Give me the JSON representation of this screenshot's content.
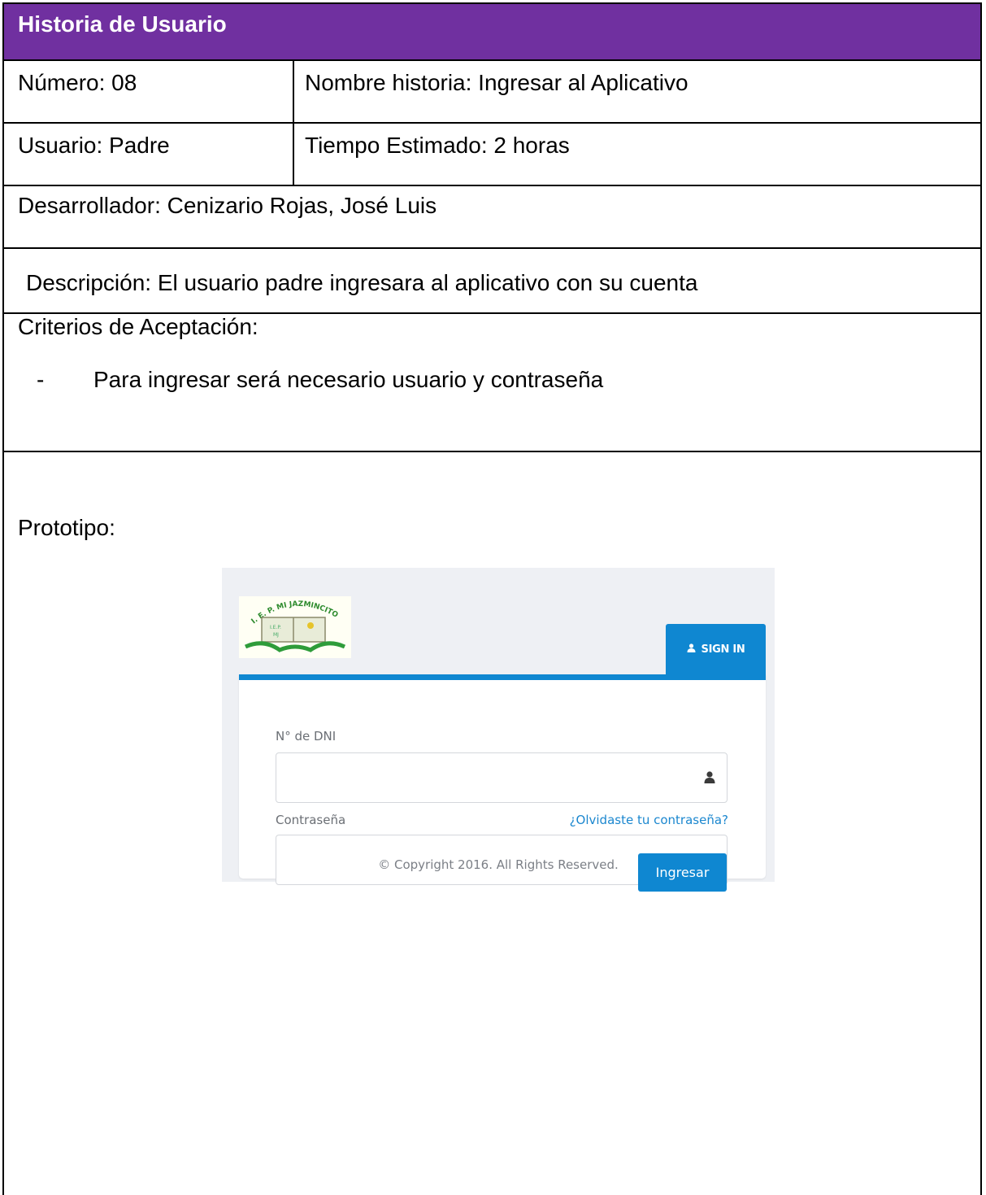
{
  "header": {
    "title": "Historia de Usuario"
  },
  "row1": {
    "numero": "Número: 08",
    "nombre": "Nombre historia: Ingresar al Aplicativo"
  },
  "row2": {
    "usuario": "Usuario: Padre",
    "tiempo": "Tiempo Estimado: 2 horas"
  },
  "desarrollador": "Desarrollador: Cenizario Rojas, José Luis",
  "descripcion": "Descripción: El usuario padre ingresara al aplicativo con su cuenta",
  "criterios": {
    "title": "Criterios de Aceptación:",
    "bullet": "-",
    "items": [
      "Para ingresar será necesario usuario y contraseña"
    ]
  },
  "prototipo": {
    "label": "Prototipo:",
    "logo_text": "I. E. P. MI JAZMINCITO",
    "tab_label": "SIGN IN",
    "dni_label": "N° de DNI",
    "password_label": "Contraseña",
    "forgot_link": "¿Olvidaste tu contraseña?",
    "submit_label": "Ingresar",
    "copyright": "© Copyright 2016. All Rights Reserved.",
    "colors": {
      "accent": "#0f87d1",
      "header_purple": "#7030a0"
    },
    "icons": [
      "user-icon",
      "lock-icon"
    ]
  }
}
